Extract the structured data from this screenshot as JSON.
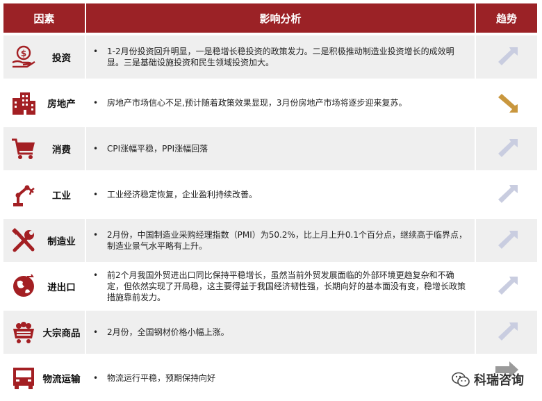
{
  "header": {
    "col_factor": "因素",
    "col_analysis": "影响分析",
    "col_trend": "趋势"
  },
  "colors": {
    "header_bg": "#9b2226",
    "icon_red": "#a31f23",
    "arrow_up": "#c9cde0",
    "arrow_down": "#c9973e",
    "arrow_right": "#9a9a9a"
  },
  "rows": [
    {
      "factor": "投资",
      "icon": "money-hand-icon",
      "trend": "up-right",
      "text": "1-2月份投资回升明显，一是稳增长稳投资的政策发力。二是积极推动制造业投资增长的成效明显。三是基础设施投资和民生领域投资加大。"
    },
    {
      "factor": "房地产",
      "icon": "buildings-icon",
      "trend": "down-right",
      "text": "房地产市场信心不足,预计随着政策效果显现，3月份房地产市场将逐步迎来复苏。"
    },
    {
      "factor": "消费",
      "icon": "shopping-cart-icon",
      "trend": "up-right",
      "text": "CPI涨幅平稳，PPI涨幅回落"
    },
    {
      "factor": "工业",
      "icon": "robot-arm-icon",
      "trend": "up-right",
      "text": "工业经济稳定恢复，企业盈利持续改善。"
    },
    {
      "factor": "制造业",
      "icon": "tools-icon",
      "trend": "up-right",
      "text": "2月份，中国制造业采购经理指数（PMI）为50.2%，比上月上升0.1个百分点，继续高于临界点，制造业景气水平略有上升。"
    },
    {
      "factor": "进出口",
      "icon": "globe-exchange-icon",
      "trend": "up-right",
      "text": "前2个月我国外贸进出口同比保持平稳增长，虽然当前外贸发展面临的外部环境更趋复杂和不确定，但依然实现了开局稳，这主要得益于我国经济韧性强，长期向好的基本面没有变，稳增长政策措施靠前发力。"
    },
    {
      "factor": "大宗商品",
      "icon": "mine-cart-icon",
      "trend": "up-right",
      "text": "2月份，全国钢材价格小幅上涨。"
    },
    {
      "factor": "物流运输",
      "icon": "truck-icon",
      "trend": "right",
      "text": "物流运行平稳，预期保持向好"
    }
  ],
  "watermark": {
    "text": "科瑞咨询",
    "icon": "wechat-icon"
  }
}
